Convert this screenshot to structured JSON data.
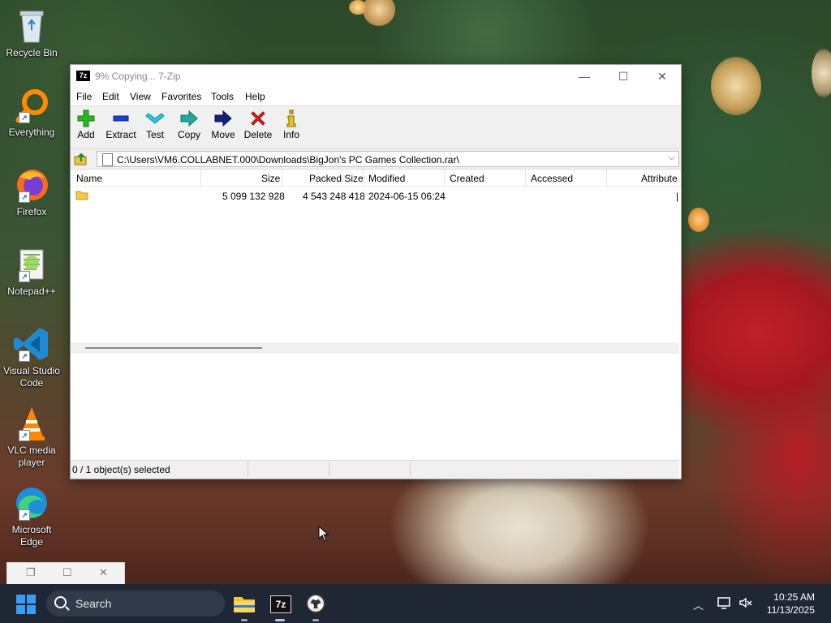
{
  "desktop": {
    "icons": [
      {
        "label": "Recycle Bin",
        "icon": "recycle-bin-icon"
      },
      {
        "label": "Everything",
        "icon": "everything-search-icon"
      },
      {
        "label": "Firefox",
        "icon": "firefox-icon"
      },
      {
        "label": "Notepad++",
        "icon": "notepad-plus-plus-icon"
      },
      {
        "label": "Visual Studio Code",
        "icon": "vscode-icon"
      },
      {
        "label": "VLC media player",
        "icon": "vlc-icon"
      },
      {
        "label": "Microsoft Edge",
        "icon": "edge-icon"
      }
    ]
  },
  "window": {
    "title": "9% Copying... 7-Zip",
    "app_icon_text": "7z",
    "menu": [
      "File",
      "Edit",
      "View",
      "Favorites",
      "Tools",
      "Help"
    ],
    "toolbar": [
      {
        "label": "Add",
        "icon": "add-plus-icon"
      },
      {
        "label": "Extract",
        "icon": "extract-minus-icon"
      },
      {
        "label": "Test",
        "icon": "test-check-icon"
      },
      {
        "label": "Copy",
        "icon": "copy-arrow-icon"
      },
      {
        "label": "Move",
        "icon": "move-arrow-icon"
      },
      {
        "label": "Delete",
        "icon": "delete-x-icon"
      },
      {
        "label": "Info",
        "icon": "info-icon"
      }
    ],
    "address": "C:\\Users\\VM6.COLLABNET.000\\Downloads\\BigJon's PC Games Collection.rar\\",
    "columns": [
      "Name",
      "Size",
      "Packed Size",
      "Modified",
      "Created",
      "Accessed",
      "Attribute"
    ],
    "rows": [
      {
        "name": "",
        "size": "5 099 132 928",
        "packed": "4 543 248 418",
        "modified": "2024-06-15 06:24",
        "created": "",
        "accessed": "",
        "attr": "|"
      }
    ],
    "status": "0 / 1 object(s) selected"
  },
  "taskbar": {
    "search_label": "Search",
    "time": "10:25 AM",
    "date": "11/13/2025",
    "apps": [
      "file-explorer-icon",
      "7zip-icon",
      "obs-icon"
    ],
    "colors": {
      "taskbar_bg": "#1f2634",
      "start_blue": "#3a9df5"
    }
  }
}
